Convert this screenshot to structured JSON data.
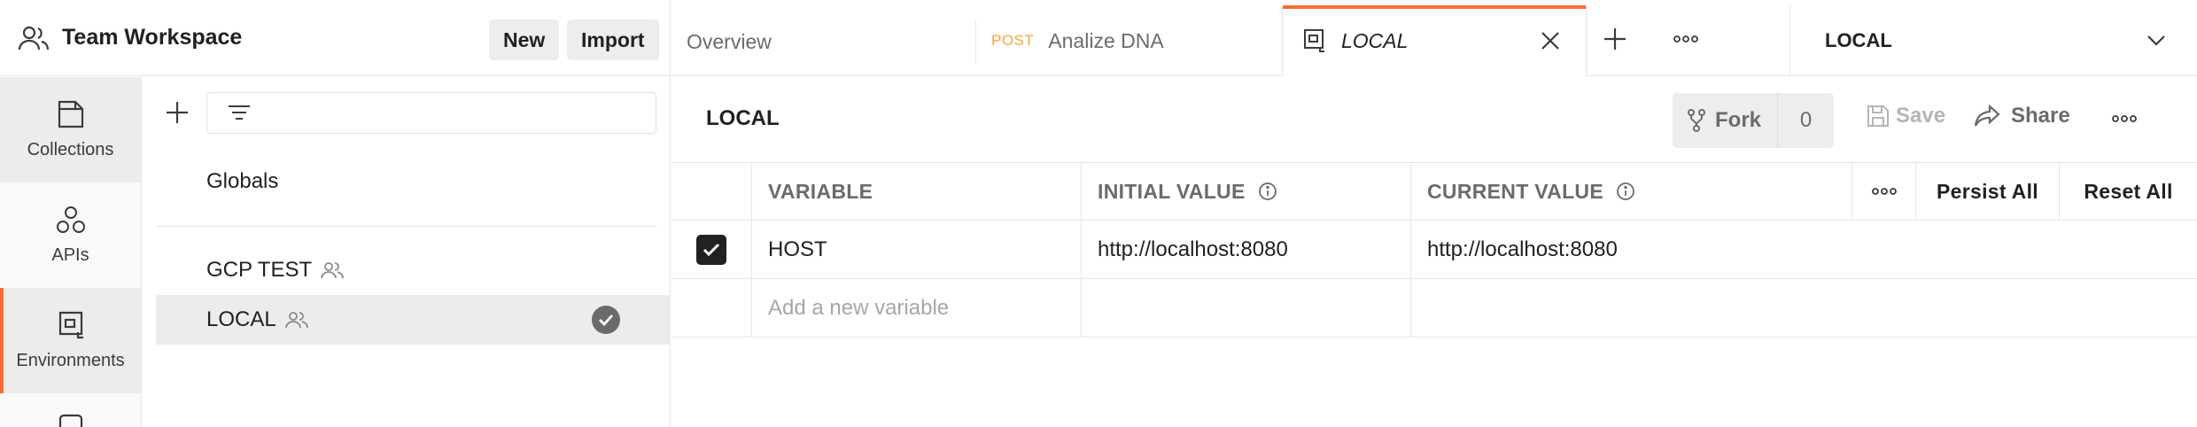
{
  "workspace": {
    "title": "Team Workspace",
    "new_label": "New",
    "import_label": "Import"
  },
  "rail": {
    "items": [
      {
        "label": "Collections",
        "icon": "collections-icon"
      },
      {
        "label": "APIs",
        "icon": "apis-icon"
      },
      {
        "label": "Environments",
        "icon": "environments-icon"
      }
    ]
  },
  "env_list": {
    "globals_label": "Globals",
    "environments": [
      {
        "name": "GCP TEST",
        "shared": true,
        "active": false
      },
      {
        "name": "LOCAL",
        "shared": true,
        "active": true
      }
    ]
  },
  "tabs": [
    {
      "label": "Overview"
    },
    {
      "method": "POST",
      "label": "Analize DNA"
    },
    {
      "label": "LOCAL",
      "active": true
    }
  ],
  "env_selector": {
    "value": "LOCAL"
  },
  "editor": {
    "title": "LOCAL",
    "fork_label": "Fork",
    "fork_count": "0",
    "save_label": "Save",
    "share_label": "Share"
  },
  "table": {
    "headers": {
      "variable": "VARIABLE",
      "initial_value": "INITIAL VALUE",
      "current_value": "CURRENT VALUE",
      "persist_all": "Persist All",
      "reset_all": "Reset All"
    },
    "rows": [
      {
        "checked": true,
        "variable": "HOST",
        "initial_value": "http://localhost:8080",
        "current_value": "http://localhost:8080"
      }
    ],
    "new_variable_placeholder": "Add a new variable"
  },
  "colors": {
    "accent": "#ff6c37",
    "method_post": "#f3a53f"
  }
}
